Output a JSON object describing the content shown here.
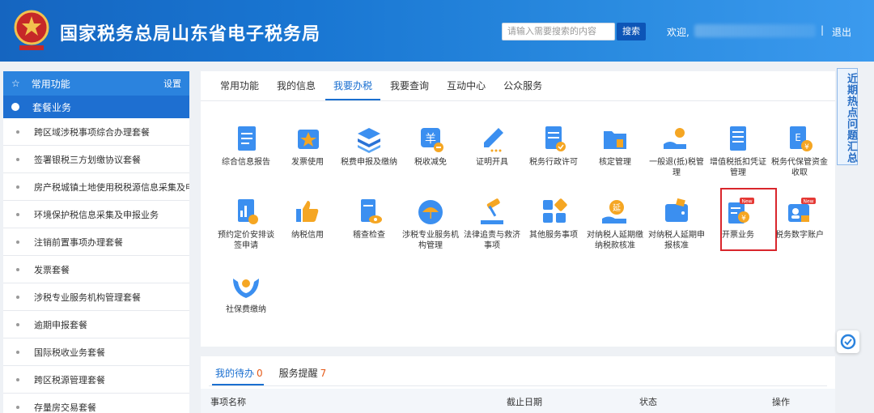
{
  "header": {
    "title": "国家税务总局山东省电子税务局",
    "search_placeholder": "请输入需要搜索的内容",
    "search_button": "搜索",
    "welcome": "欢迎,",
    "separator": "|",
    "logout": "退出"
  },
  "sidebar": {
    "common_label": "常用功能",
    "settings_label": "设置",
    "package_label": "套餐业务",
    "items": [
      "跨区域涉税事项综合办理套餐",
      "签署银税三方划缴协议套餐",
      "房产税城镇土地使用税税源信息采集及申...",
      "环境保护税信息采集及申报业务",
      "注销前置事项办理套餐",
      "发票套餐",
      "涉税专业服务机构管理套餐",
      "逾期申报套餐",
      "国际税收业务套餐",
      "跨区税源管理套餐",
      "存量房交易套餐"
    ]
  },
  "main": {
    "tabs": [
      "常用功能",
      "我的信息",
      "我要办税",
      "我要查询",
      "互动中心",
      "公众服务"
    ],
    "active_tab": "我要办税",
    "tiles_row1": [
      "综合信息报告",
      "发票使用",
      "税费申报及缴纳",
      "税收减免",
      "证明开具",
      "税务行政许可",
      "核定管理",
      "一般退(抵)税管理",
      "增值税抵扣凭证管理",
      "税务代保管资金收取"
    ],
    "tiles_row2": [
      "预约定价安排谈签申请",
      "纳税信用",
      "稽查检查",
      "涉税专业服务机构管理",
      "法律追责与救济事项",
      "其他服务事项",
      "对纳税人延期缴纳税款核准",
      "对纳税人延期申报核准",
      "开票业务",
      "税务数字账户"
    ],
    "tiles_row3": [
      "社保费缴纳"
    ],
    "new_badge": "New",
    "reduce_glyph": "羊",
    "extend_glyph": "延",
    "yen_glyph": "¥"
  },
  "hot_panel": "近期热点问题汇总",
  "bottom": {
    "todo_label": "我的待办",
    "todo_count": "0",
    "reminder_label": "服务提醒",
    "reminder_count": "7",
    "columns": [
      "事项名称",
      "截止日期",
      "状态",
      "操作"
    ]
  },
  "colors": {
    "header_blue": "#1976d2",
    "accent": "#1a6fd0",
    "highlight_red": "#d9262c",
    "count_orange": "#e55a18"
  }
}
